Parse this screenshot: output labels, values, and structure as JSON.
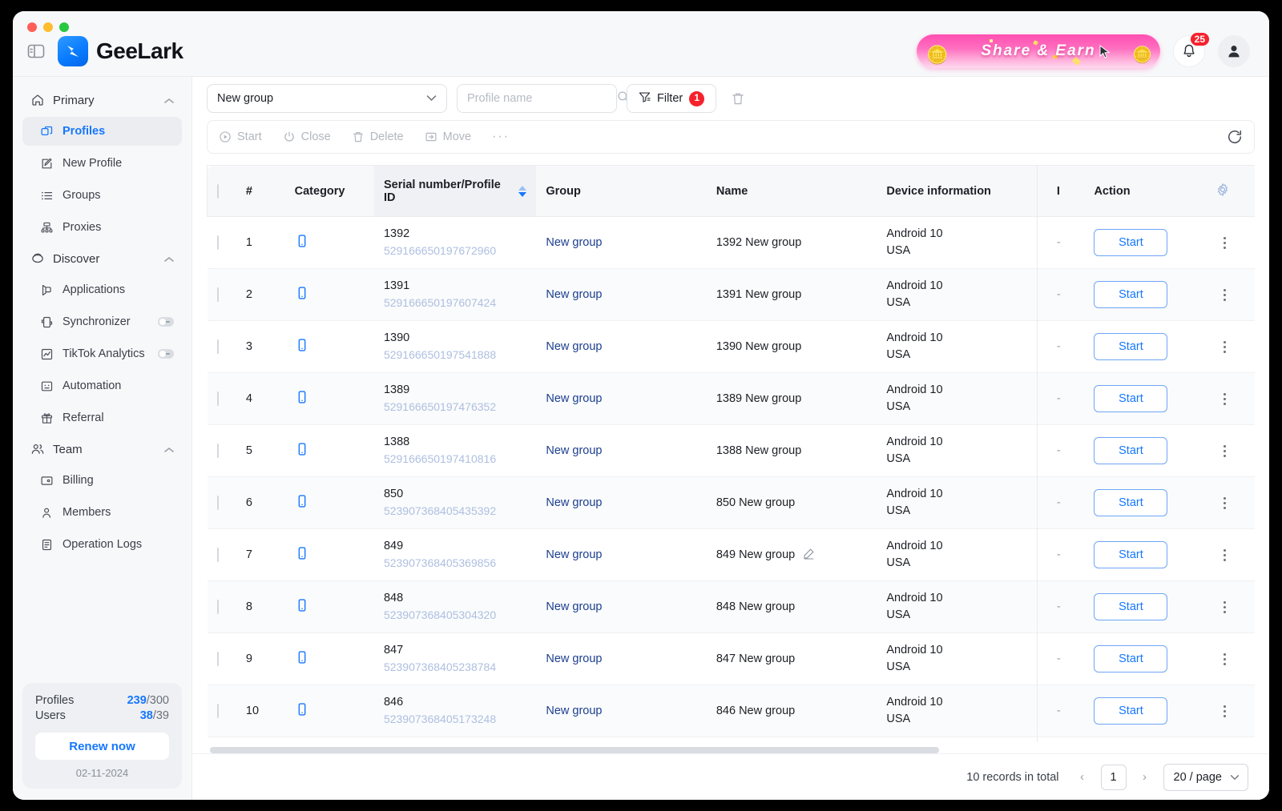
{
  "app": {
    "brand": "GeeLark",
    "panel_toggle_icon": "panel-toggle-icon",
    "logo_icon": "geelark-logo-icon"
  },
  "header": {
    "promo_label": "Share & Earn",
    "notification_badge": "25",
    "bell_icon": "bell-icon",
    "avatar_icon": "user-avatar-icon"
  },
  "sidebar": {
    "groups": [
      {
        "label": "Primary",
        "icon": "home-icon",
        "items": [
          {
            "label": "Profiles",
            "icon": "profiles-icon",
            "active": true
          },
          {
            "label": "New Profile",
            "icon": "new-profile-icon",
            "active": false
          },
          {
            "label": "Groups",
            "icon": "groups-icon",
            "active": false
          },
          {
            "label": "Proxies",
            "icon": "proxies-icon",
            "active": false
          }
        ]
      },
      {
        "label": "Discover",
        "icon": "discover-icon",
        "items": [
          {
            "label": "Applications",
            "icon": "applications-icon",
            "active": false
          },
          {
            "label": "Synchronizer",
            "icon": "synchronizer-icon",
            "active": false,
            "toggle": true
          },
          {
            "label": "TikTok Analytics",
            "icon": "analytics-icon",
            "active": false,
            "toggle": true
          },
          {
            "label": "Automation",
            "icon": "automation-icon",
            "active": false
          },
          {
            "label": "Referral",
            "icon": "referral-icon",
            "active": false
          }
        ]
      },
      {
        "label": "Team",
        "icon": "team-icon",
        "items": [
          {
            "label": "Billing",
            "icon": "billing-icon",
            "active": false
          },
          {
            "label": "Members",
            "icon": "members-icon",
            "active": false
          },
          {
            "label": "Operation Logs",
            "icon": "operation-logs-icon",
            "active": false
          }
        ]
      }
    ],
    "quota": {
      "profiles_label": "Profiles",
      "profiles_used": "239",
      "profiles_total": "/300",
      "users_label": "Users",
      "users_used": "38",
      "users_total": "/39",
      "renew_label": "Renew now",
      "date": "02-11-2024"
    }
  },
  "toolbar": {
    "group_select_value": "New group",
    "search_placeholder": "Profile name",
    "search_value": "",
    "search_icon": "search-icon",
    "filter_label": "Filter",
    "filter_count": "1",
    "filter_icon": "filter-icon",
    "trash_icon": "trash-icon",
    "actions": [
      {
        "label": "Start",
        "icon": "play-circle-icon"
      },
      {
        "label": "Close",
        "icon": "power-icon"
      },
      {
        "label": "Delete",
        "icon": "trash-icon"
      },
      {
        "label": "Move",
        "icon": "move-icon"
      }
    ],
    "more_label": "···",
    "refresh_icon": "refresh-icon"
  },
  "table": {
    "columns": [
      "#",
      "Category",
      "Serial number/Profile ID",
      "Group",
      "Name",
      "Device information",
      "I",
      "Action"
    ],
    "sorted_column": "Serial number/Profile ID",
    "settings_icon": "gear-icon",
    "rows": [
      {
        "index": "1",
        "category_icon": "phone-icon",
        "serial": "1392",
        "profile_id": "529166650197672960",
        "group": "New group",
        "name": "1392 New group",
        "editable": false,
        "os": "Android 10",
        "country": "USA",
        "ip": "-",
        "action": "Start"
      },
      {
        "index": "2",
        "category_icon": "phone-icon",
        "serial": "1391",
        "profile_id": "529166650197607424",
        "group": "New group",
        "name": "1391 New group",
        "editable": false,
        "os": "Android 10",
        "country": "USA",
        "ip": "-",
        "action": "Start"
      },
      {
        "index": "3",
        "category_icon": "phone-icon",
        "serial": "1390",
        "profile_id": "529166650197541888",
        "group": "New group",
        "name": "1390 New group",
        "editable": false,
        "os": "Android 10",
        "country": "USA",
        "ip": "-",
        "action": "Start"
      },
      {
        "index": "4",
        "category_icon": "phone-icon",
        "serial": "1389",
        "profile_id": "529166650197476352",
        "group": "New group",
        "name": "1389 New group",
        "editable": false,
        "os": "Android 10",
        "country": "USA",
        "ip": "-",
        "action": "Start"
      },
      {
        "index": "5",
        "category_icon": "phone-icon",
        "serial": "1388",
        "profile_id": "529166650197410816",
        "group": "New group",
        "name": "1388 New group",
        "editable": false,
        "os": "Android 10",
        "country": "USA",
        "ip": "-",
        "action": "Start"
      },
      {
        "index": "6",
        "category_icon": "phone-icon",
        "serial": "850",
        "profile_id": "523907368405435392",
        "group": "New group",
        "name": "850 New group",
        "editable": false,
        "os": "Android 10",
        "country": "USA",
        "ip": "-",
        "action": "Start"
      },
      {
        "index": "7",
        "category_icon": "phone-icon",
        "serial": "849",
        "profile_id": "523907368405369856",
        "group": "New group",
        "name": "849 New group",
        "editable": true,
        "os": "Android 10",
        "country": "USA",
        "ip": "-",
        "action": "Start"
      },
      {
        "index": "8",
        "category_icon": "phone-icon",
        "serial": "848",
        "profile_id": "523907368405304320",
        "group": "New group",
        "name": "848 New group",
        "editable": false,
        "os": "Android 10",
        "country": "USA",
        "ip": "-",
        "action": "Start"
      },
      {
        "index": "9",
        "category_icon": "phone-icon",
        "serial": "847",
        "profile_id": "523907368405238784",
        "group": "New group",
        "name": "847 New group",
        "editable": false,
        "os": "Android 10",
        "country": "USA",
        "ip": "-",
        "action": "Start"
      },
      {
        "index": "10",
        "category_icon": "phone-icon",
        "serial": "846",
        "profile_id": "523907368405173248",
        "group": "New group",
        "name": "846 New group",
        "editable": false,
        "os": "Android 10",
        "country": "USA",
        "ip": "-",
        "action": "Start"
      }
    ]
  },
  "footer": {
    "records_total": "10 records in total",
    "prev_label": "‹",
    "current_page": "1",
    "next_label": "›",
    "page_size": "20 / page"
  },
  "colors": {
    "accent": "#1677ff",
    "danger": "#f5222d",
    "promo_pink": "#ff4fb0",
    "sidebar_bg": "#f7f8fa",
    "link": "#1d3f8f",
    "muted_id": "#aebfe0"
  }
}
